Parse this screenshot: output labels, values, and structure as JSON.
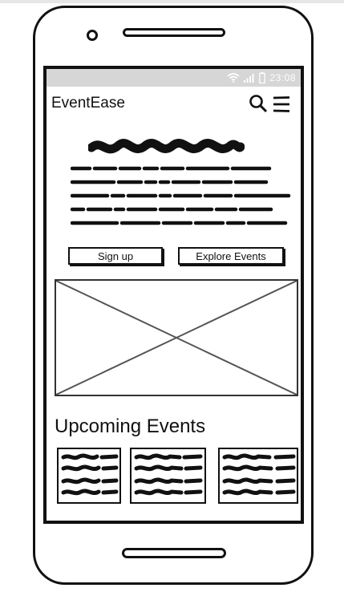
{
  "status_bar": {
    "time": "23:08",
    "icons": [
      "wifi-icon",
      "signal-icon",
      "battery-icon"
    ]
  },
  "app": {
    "title": "EventEase",
    "header_icons": [
      "search-icon",
      "menu-icon"
    ]
  },
  "hero": {
    "buttons": {
      "signup_label": "Sign up",
      "explore_label": "Explore Events"
    }
  },
  "events": {
    "section_title": "Upcoming Events"
  },
  "colors": {
    "frame": "#111111",
    "status_bar": "#d6d6d6",
    "placeholder_stroke": "#555555"
  }
}
